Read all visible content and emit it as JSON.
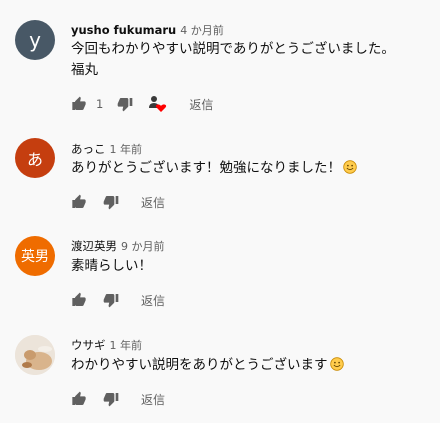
{
  "comments": [
    {
      "author": "yusho fukumaru",
      "time": "4 か月前",
      "avatar_letter": "y",
      "avatar_color": "#485866",
      "lines": [
        "今回もわかりやすい説明でありがとうございました。",
        "福丸"
      ],
      "likes": "1",
      "hearted": true,
      "reply_label": "返信"
    },
    {
      "author": "あっこ",
      "time": "1 年前",
      "avatar_letter": "あ",
      "avatar_color": "#c53e0f",
      "lines": [
        "ありがとうございます！勉強になりました！"
      ],
      "likes": "",
      "hearted": false,
      "reply_label": "返信"
    },
    {
      "author": "渡辺英男",
      "time": "9 か月前",
      "avatar_letter": "英男",
      "avatar_color": "#ef6c00",
      "lines": [
        "素晴らしい！"
      ],
      "likes": "",
      "hearted": false,
      "reply_label": "返信"
    },
    {
      "author": "ウサギ",
      "time": "1 年前",
      "avatar_letter": "",
      "avatar_color": "#e8ded4",
      "lines": [
        "わかりやすい説明をありがとうございます"
      ],
      "likes": "",
      "hearted": false,
      "reply_label": "返信"
    }
  ],
  "icons": {
    "like": "thumbs-up-icon",
    "dislike": "thumbs-down-icon",
    "heart": "creator-heart-icon",
    "smile": "smiling-face-emoji"
  }
}
